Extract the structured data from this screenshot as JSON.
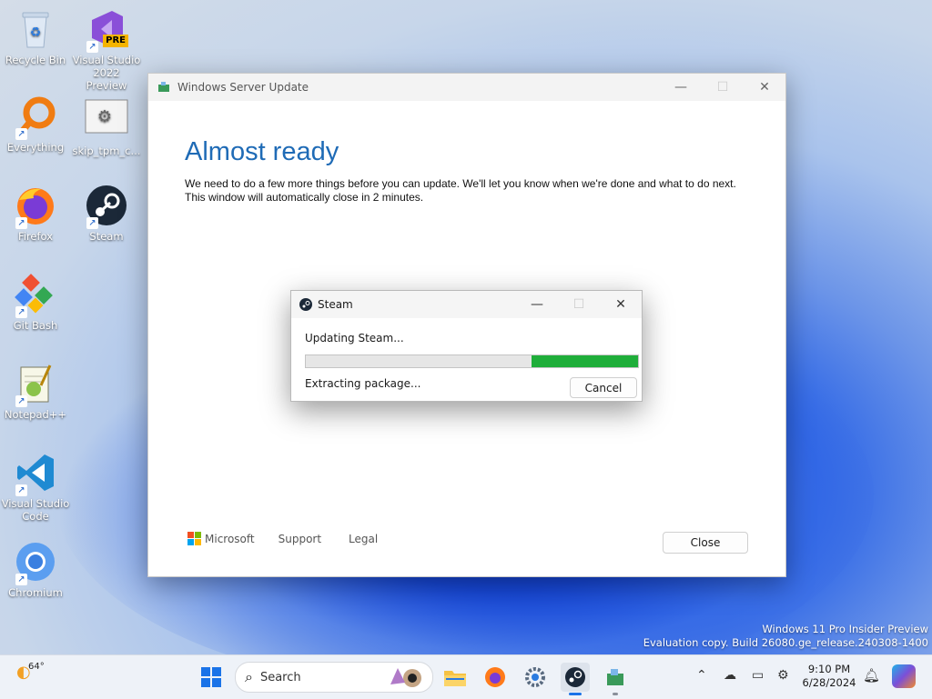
{
  "desktop": {
    "icons": [
      {
        "label": "Recycle Bin"
      },
      {
        "label": "Visual Studio 2022 Preview",
        "badge": "PRE"
      },
      {
        "label": "Everything"
      },
      {
        "label": "skip_tpm_c..."
      },
      {
        "label": "Firefox"
      },
      {
        "label": "Steam"
      },
      {
        "label": "Git Bash"
      },
      {
        "label": "Notepad++"
      },
      {
        "label": "Visual Studio Code"
      },
      {
        "label": "Chromium"
      }
    ],
    "watermark": {
      "line1": "Windows 11 Pro Insider Preview",
      "line2": "Evaluation copy. Build 26080.ge_release.240308-1400"
    }
  },
  "setup_window": {
    "title": "Windows Server Update",
    "heading": "Almost ready",
    "body_line1": "We need to do a few more things before you can update. We'll let you know when we're done and what to do next.",
    "body_line2": "This window will automatically close in 2 minutes.",
    "footer": {
      "brand": "Microsoft",
      "support": "Support",
      "legal": "Legal"
    },
    "close_button": "Close",
    "heading_color": "#1f6bb6"
  },
  "steam_dialog": {
    "title": "Steam",
    "status": "Updating Steam...",
    "progress_fraction": 0.32,
    "progress_color": "#1fae3a",
    "detail": "Extracting package...",
    "cancel_button": "Cancel"
  },
  "taskbar": {
    "weather_temp": "64°",
    "search_placeholder": "Search",
    "time": "9:10 PM",
    "date": "6/28/2024"
  }
}
